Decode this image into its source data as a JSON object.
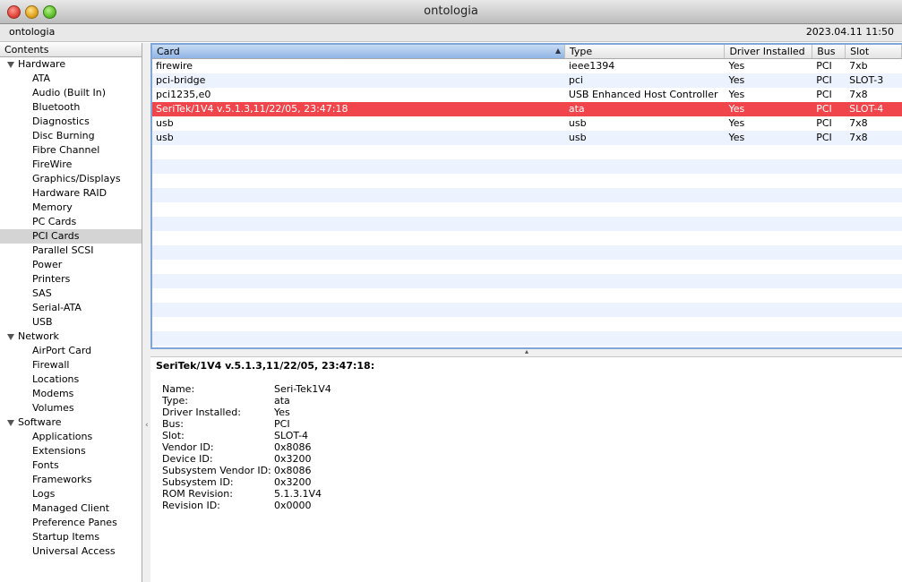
{
  "window": {
    "title": "ontologia"
  },
  "infobar": {
    "machine": "ontologia",
    "datetime": "2023.04.11 11:50"
  },
  "sidebar": {
    "header": "Contents",
    "groups": [
      {
        "label": "Hardware",
        "items": [
          "ATA",
          "Audio (Built In)",
          "Bluetooth",
          "Diagnostics",
          "Disc Burning",
          "Fibre Channel",
          "FireWire",
          "Graphics/Displays",
          "Hardware RAID",
          "Memory",
          "PC Cards",
          "PCI Cards",
          "Parallel SCSI",
          "Power",
          "Printers",
          "SAS",
          "Serial-ATA",
          "USB"
        ]
      },
      {
        "label": "Network",
        "items": [
          "AirPort Card",
          "Firewall",
          "Locations",
          "Modems",
          "Volumes"
        ]
      },
      {
        "label": "Software",
        "items": [
          "Applications",
          "Extensions",
          "Fonts",
          "Frameworks",
          "Logs",
          "Managed Client",
          "Preference Panes",
          "Startup Items",
          "Universal Access"
        ]
      }
    ],
    "selected": "PCI Cards"
  },
  "table": {
    "columns": [
      "Card",
      "Type",
      "Driver Installed",
      "Bus",
      "Slot"
    ],
    "sorted_column": "Card",
    "rows": [
      [
        "firewire",
        "ieee1394",
        "Yes",
        "PCI",
        "7xb"
      ],
      [
        "pci-bridge",
        "pci",
        "Yes",
        "PCI",
        "SLOT-3"
      ],
      [
        "pci1235,e0",
        "USB Enhanced Host Controller",
        "Yes",
        "PCI",
        "7x8"
      ],
      [
        "SeriTek/1V4 v.5.1.3,11/22/05, 23:47:18",
        "ata",
        "Yes",
        "PCI",
        "SLOT-4"
      ],
      [
        "usb",
        "usb",
        "Yes",
        "PCI",
        "7x8"
      ],
      [
        "usb",
        "usb",
        "Yes",
        "PCI",
        "7x8"
      ]
    ],
    "selected_row": 3,
    "selection_color": "#f0454b"
  },
  "detail": {
    "title": "SeriTek/1V4 v.5.1.3,11/22/05, 23:47:18:",
    "fields": [
      {
        "key": "Name:",
        "value": "Seri-Tek1V4"
      },
      {
        "key": "Type:",
        "value": "ata"
      },
      {
        "key": "Driver Installed:",
        "value": "Yes"
      },
      {
        "key": "Bus:",
        "value": "PCI"
      },
      {
        "key": "Slot:",
        "value": "SLOT-4"
      },
      {
        "key": "Vendor ID:",
        "value": "0x8086"
      },
      {
        "key": "Device ID:",
        "value": "0x3200"
      },
      {
        "key": "Subsystem Vendor ID:",
        "value": "0x8086"
      },
      {
        "key": "Subsystem ID:",
        "value": "0x3200"
      },
      {
        "key": "ROM Revision:",
        "value": "5.1.3.1V4"
      },
      {
        "key": "Revision ID:",
        "value": "0x0000"
      }
    ]
  }
}
